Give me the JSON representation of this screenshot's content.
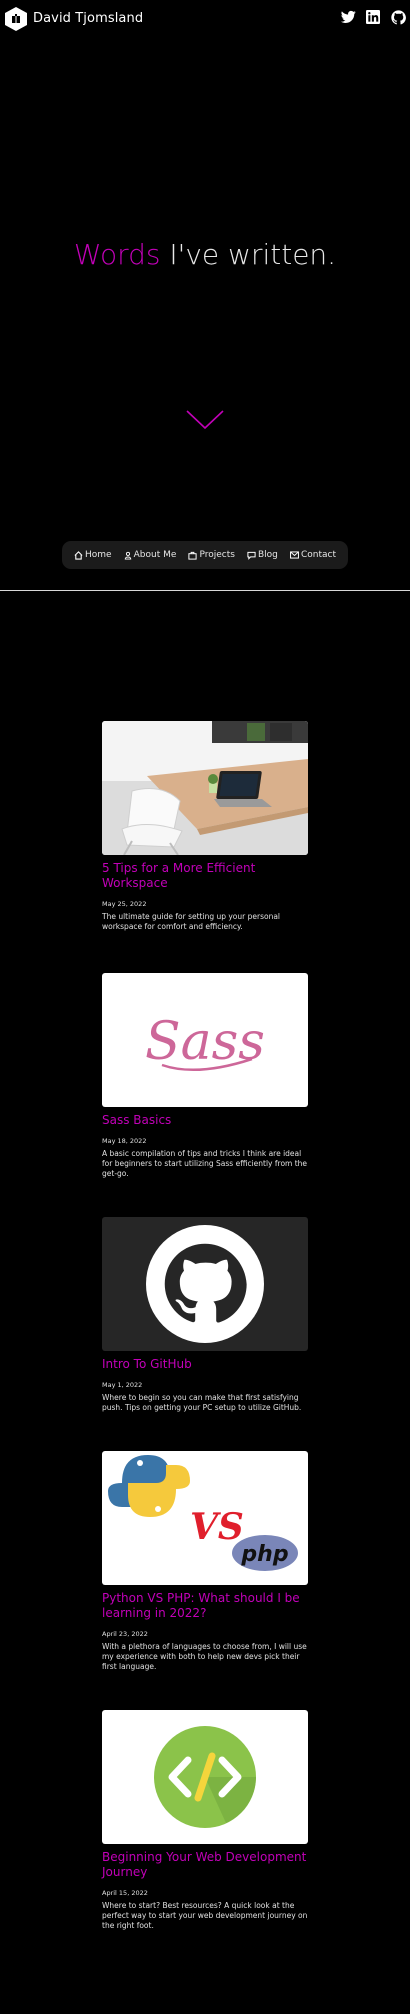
{
  "header": {
    "brand": "David Tjomsland",
    "social": [
      "twitter-icon",
      "linkedin-icon",
      "github-icon"
    ]
  },
  "hero": {
    "accent": "Words",
    "rest": "I've written."
  },
  "nav": {
    "items": [
      {
        "label": "Home",
        "icon": "home-icon"
      },
      {
        "label": "About Me",
        "icon": "person-icon"
      },
      {
        "label": "Projects",
        "icon": "briefcase-icon"
      },
      {
        "label": "Blog",
        "icon": "chat-icon"
      },
      {
        "label": "Contact",
        "icon": "mail-icon"
      }
    ]
  },
  "posts": [
    {
      "title": "5 Tips for a More Efficient Workspace",
      "date": "May 25, 2022",
      "description": "The ultimate guide for setting up your personal workspace for comfort and efficiency."
    },
    {
      "title": "Sass Basics",
      "date": "May 18, 2022",
      "description": "A basic compilation of tips and tricks I think are ideal for beginners to start utilizing Sass efficiently from the get-go.",
      "image_text": "Sass"
    },
    {
      "title": "Intro To GitHub",
      "date": "May 1, 2022",
      "description": "Where to begin so you can make that first satisfying push. Tips on getting your PC setup to utilize GitHub."
    },
    {
      "title": "Python VS PHP: What should I be learning in 2022?",
      "date": "April 23, 2022",
      "description": "With a plethora of languages to choose from, I will use my experience with both to help new devs pick their first language.",
      "image_vs": "VS",
      "image_php": "php"
    },
    {
      "title": "Beginning Your Web Development Journey",
      "date": "April 15, 2022",
      "description": "Where to start? Best resources? A quick look at the perfect way to start your web development journey on the right foot."
    }
  ],
  "colors": {
    "accent": "#c200b8",
    "background": "#000000",
    "nav_bg": "#1b1b1b"
  }
}
